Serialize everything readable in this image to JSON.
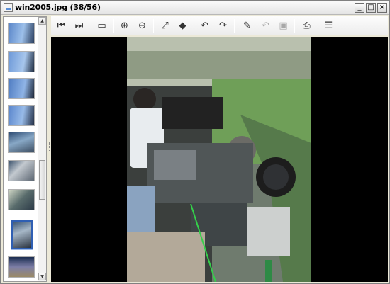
{
  "window": {
    "title": "win2005.jpg (38/56)",
    "controls": {
      "minimize": "_",
      "maximize": "□",
      "close": "×"
    }
  },
  "sidebar": {
    "thumbnails": [
      {
        "name": "thumb-1",
        "selected": false
      },
      {
        "name": "thumb-2",
        "selected": false
      },
      {
        "name": "thumb-3",
        "selected": false
      },
      {
        "name": "thumb-4",
        "selected": false
      },
      {
        "name": "thumb-5",
        "selected": false
      },
      {
        "name": "thumb-6",
        "selected": false
      },
      {
        "name": "thumb-7",
        "selected": false
      },
      {
        "name": "thumb-8",
        "selected": true
      },
      {
        "name": "thumb-9",
        "selected": false
      }
    ],
    "scroll_up": "▲",
    "scroll_down": "▼"
  },
  "toolbar": {
    "first": "⏮",
    "next": "⏭",
    "slideshow": "▭",
    "zoom_in": "⊕",
    "zoom_out": "⊖",
    "fit": "⤢",
    "actual": "◆",
    "rotate_left": "↶",
    "rotate_right": "↷",
    "edit": "✎",
    "undo": "↶",
    "save": "▣",
    "print": "⎙",
    "properties": "☰"
  },
  "colors": {
    "window_bg": "#ece9d8",
    "viewer_bg": "#000000",
    "selected_border": "#2f5fb3"
  }
}
